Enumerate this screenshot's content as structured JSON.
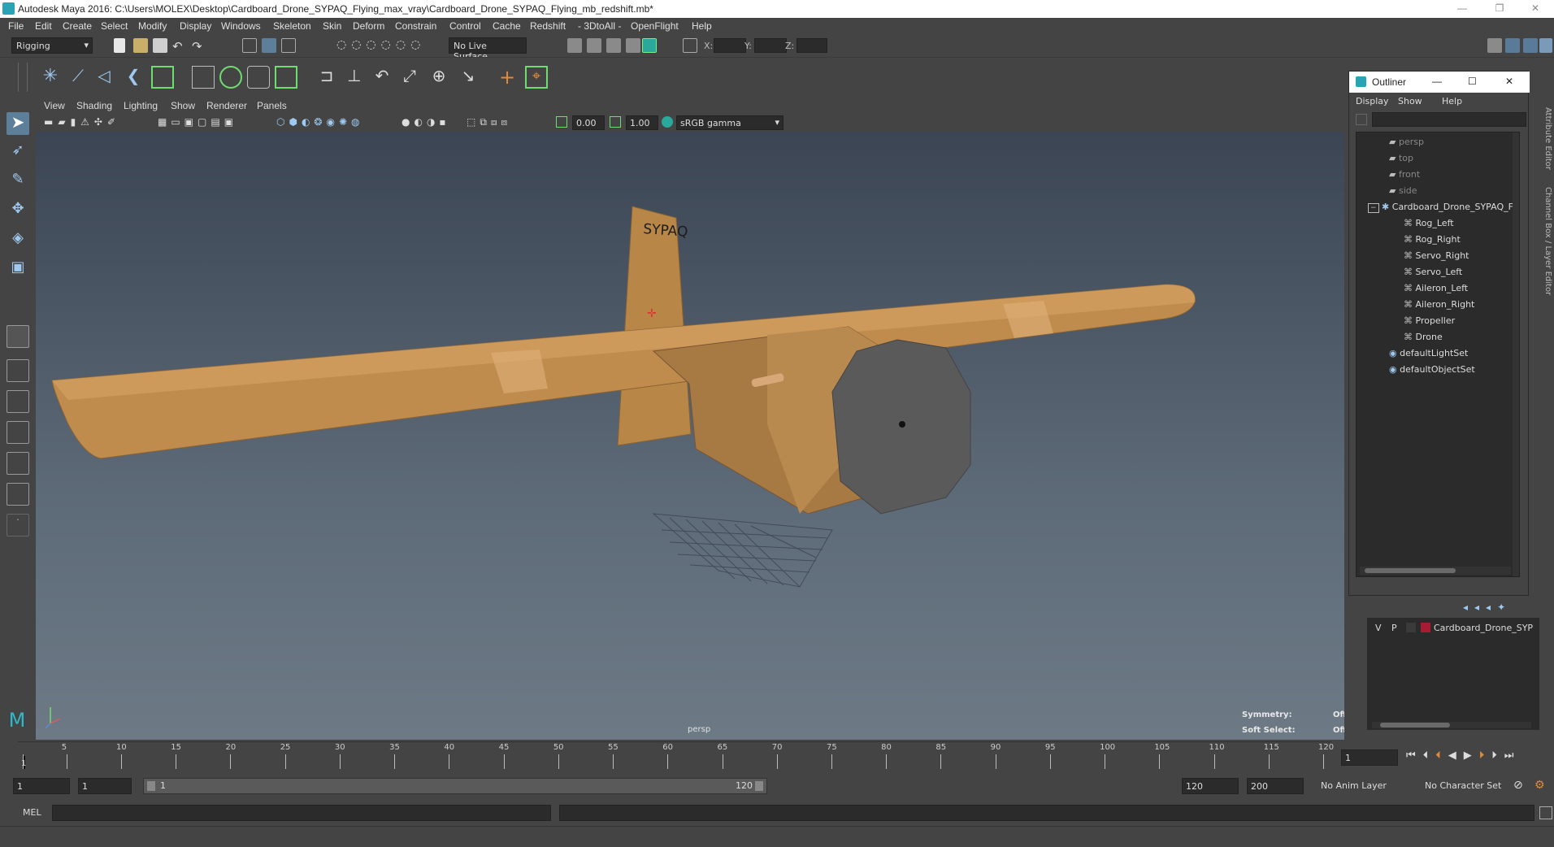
{
  "window": {
    "title": "Autodesk Maya 2016: C:\\Users\\MOLEX\\Desktop\\Cardboard_Drone_SYPAQ_Flying_max_vray\\Cardboard_Drone_SYPAQ_Flying_mb_redshift.mb*",
    "minimize": "—",
    "restore": "❐",
    "close": "✕"
  },
  "menubar": [
    "File",
    "Edit",
    "Create",
    "Select",
    "Modify",
    "Display",
    "Windows",
    "Skeleton",
    "Skin",
    "Deform",
    "Constrain",
    "Control",
    "Cache",
    "Redshift",
    "- 3DtoAll -",
    "OpenFlight",
    "Help"
  ],
  "statusline": {
    "mode": "Rigging",
    "live_surface": "No Live Surface",
    "x_label": "X:",
    "y_label": "Y:",
    "z_label": "Z:"
  },
  "viewport": {
    "menu": [
      "View",
      "Shading",
      "Lighting",
      "Show",
      "Renderer",
      "Panels"
    ],
    "exposure": "0.00",
    "gamma": "1.00",
    "color_space": "sRGB gamma",
    "camera_label": "persp",
    "model_label": "SYPAQ",
    "hud": {
      "symmetry_label": "Symmetry:",
      "symmetry_value": "Off",
      "soft_select_label": "Soft Select:",
      "soft_select_value": "Off"
    }
  },
  "outliner": {
    "title": "Outliner",
    "menu": [
      "Display",
      "Show",
      "Help"
    ],
    "items": [
      {
        "label": "persp",
        "kind": "camera",
        "indent": 0
      },
      {
        "label": "top",
        "kind": "camera",
        "indent": 0
      },
      {
        "label": "front",
        "kind": "camera",
        "indent": 0
      },
      {
        "label": "side",
        "kind": "camera",
        "indent": 0
      },
      {
        "label": "Cardboard_Drone_SYPAQ_F",
        "kind": "group",
        "indent": 0
      },
      {
        "label": "Rog_Left",
        "kind": "mesh",
        "indent": 1
      },
      {
        "label": "Rog_Right",
        "kind": "mesh",
        "indent": 1
      },
      {
        "label": "Servo_Right",
        "kind": "mesh",
        "indent": 1
      },
      {
        "label": "Servo_Left",
        "kind": "mesh",
        "indent": 1
      },
      {
        "label": "Aileron_Left",
        "kind": "mesh",
        "indent": 1
      },
      {
        "label": "Aileron_Right",
        "kind": "mesh",
        "indent": 1
      },
      {
        "label": "Propeller",
        "kind": "mesh",
        "indent": 1
      },
      {
        "label": "Drone",
        "kind": "mesh",
        "indent": 1
      },
      {
        "label": "defaultLightSet",
        "kind": "set",
        "indent": 0
      },
      {
        "label": "defaultObjectSet",
        "kind": "set",
        "indent": 0
      }
    ]
  },
  "side_tabs": [
    "Attribute Editor",
    "Channel Box / Layer Editor"
  ],
  "layer_editor": {
    "v": "V",
    "p": "P",
    "layer_name": "Cardboard_Drone_SYP",
    "layer_color": "#a81c33"
  },
  "timeline": {
    "ticks": [
      "1",
      "5",
      "10",
      "15",
      "20",
      "25",
      "30",
      "35",
      "40",
      "45",
      "50",
      "55",
      "60",
      "65",
      "70",
      "75",
      "80",
      "85",
      "90",
      "95",
      "100",
      "105",
      "110",
      "115",
      "120"
    ],
    "current_frame": "1"
  },
  "range": {
    "start": "1",
    "playback_start": "1",
    "slider_start": "1",
    "slider_end": "120",
    "playback_end": "120",
    "end": "200",
    "anim_layer": "No Anim Layer",
    "character_set": "No Character Set"
  },
  "cmdline": {
    "label": "MEL"
  }
}
